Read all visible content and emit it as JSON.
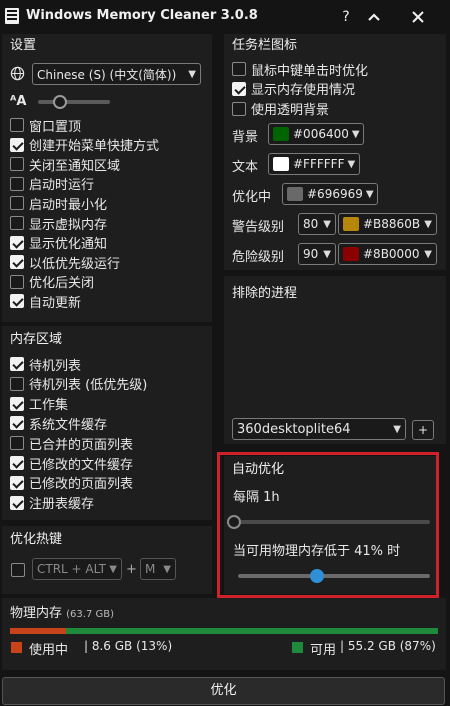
{
  "window": {
    "title": "Windows Memory Cleaner 3.0.8",
    "help": "?",
    "collapse": "∧",
    "close": "✕"
  },
  "settings": {
    "title": "设置",
    "language": "Chinese (S) (中文(简体))",
    "font_size_level": 0.3,
    "options": [
      {
        "label": "窗口置顶",
        "checked": false
      },
      {
        "label": "创建开始菜单快捷方式",
        "checked": true
      },
      {
        "label": "关闭至通知区域",
        "checked": false
      },
      {
        "label": "启动时运行",
        "checked": false
      },
      {
        "label": "启动时最小化",
        "checked": false
      },
      {
        "label": "显示虚拟内存",
        "checked": false
      },
      {
        "label": "显示优化通知",
        "checked": true
      },
      {
        "label": "以低优先级运行",
        "checked": true
      },
      {
        "label": "优化后关闭",
        "checked": false
      },
      {
        "label": "自动更新",
        "checked": true
      }
    ]
  },
  "memory_areas": {
    "title": "内存区域",
    "options": [
      {
        "label": "待机列表",
        "checked": true
      },
      {
        "label": "待机列表 (低优先级)",
        "checked": false
      },
      {
        "label": "工作集",
        "checked": true
      },
      {
        "label": "系统文件缓存",
        "checked": true
      },
      {
        "label": "已合并的页面列表",
        "checked": false
      },
      {
        "label": "已修改的文件缓存",
        "checked": true
      },
      {
        "label": "已修改的页面列表",
        "checked": true
      },
      {
        "label": "注册表缓存",
        "checked": true
      }
    ]
  },
  "hotkey": {
    "title": "优化热键",
    "enabled": false,
    "modifier": "CTRL + ALT",
    "plus": "+",
    "key": "M"
  },
  "taskbar_icon": {
    "title": "任务栏图标",
    "options": [
      {
        "label": "鼠标中键单击时优化",
        "checked": false
      },
      {
        "label": "显示内存使用情况",
        "checked": true
      },
      {
        "label": "使用透明背景",
        "checked": false
      }
    ],
    "background_label": "背景",
    "background_color": "#006400",
    "text_label": "文本",
    "text_color": "#FFFFFF",
    "optimizing_label": "优化中",
    "optimizing_color": "#696969",
    "warning_label": "警告级别",
    "warning_level": "80",
    "warning_color": "#B8860B",
    "danger_label": "危险级别",
    "danger_level": "90",
    "danger_color": "#8B0000"
  },
  "excluded_processes": {
    "title": "排除的进程",
    "selected": "360desktoplite64",
    "add": "+"
  },
  "auto_optimize": {
    "title": "自动优化",
    "interval_label": "每隔 1h",
    "interval_level": 0.0,
    "threshold_label": "当可用物理内存低于 41% 时",
    "threshold_percent": 41
  },
  "physical_memory": {
    "title": "物理内存",
    "total": "(63.7 GB)",
    "used_label": "使用中",
    "used_value": "| 8.6 GB (13%)",
    "used_percent": 13,
    "free_label": "可用",
    "free_value": "| 55.2 GB (87%)",
    "used_color": "#c8421a",
    "free_color": "#1f8a3c"
  },
  "optimize_button": "优化"
}
